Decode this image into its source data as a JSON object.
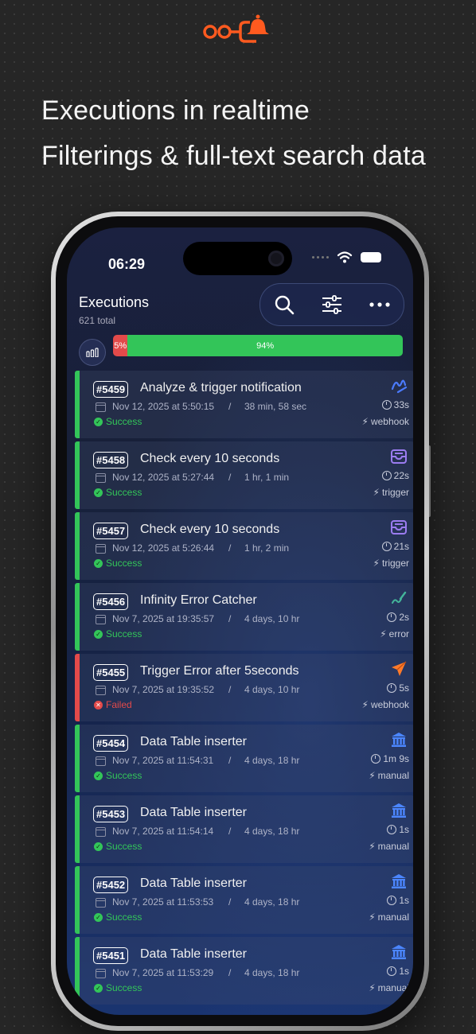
{
  "headline": {
    "line1": "Executions in realtime",
    "line2": "Filterings & full-text search data"
  },
  "status_bar": {
    "time": "06:29"
  },
  "screen": {
    "title": "Executions",
    "subtitle": "621 total",
    "toolbar": {
      "search_icon": "search-icon",
      "filter_icon": "sliders-icon",
      "more_icon": "more-icon"
    },
    "summary": {
      "failed_label": "5%",
      "success_label": "94%",
      "failed_fraction": 0.05,
      "success_fraction": 0.94
    }
  },
  "colors": {
    "success": "#33c559",
    "failed": "#e34a4a",
    "accent": "#ff5a1f"
  },
  "executions": [
    {
      "id": "#5459",
      "name": "Analyze & trigger notification",
      "date": "Nov 12, 2025 at 5:50:15",
      "ago": "38 min, 58 sec",
      "status": "Success",
      "duration": "33s",
      "trigger": "webhook",
      "icon": "webhook-icon"
    },
    {
      "id": "#5458",
      "name": "Check every 10 seconds",
      "date": "Nov 12, 2025 at 5:27:44",
      "ago": "1 hr, 1 min",
      "status": "Success",
      "duration": "22s",
      "trigger": "trigger",
      "icon": "inbox-icon"
    },
    {
      "id": "#5457",
      "name": "Check every 10 seconds",
      "date": "Nov 12, 2025 at 5:26:44",
      "ago": "1 hr, 2 min",
      "status": "Success",
      "duration": "21s",
      "trigger": "trigger",
      "icon": "inbox-icon"
    },
    {
      "id": "#5456",
      "name": "Infinity Error Catcher",
      "date": "Nov 7, 2025 at 19:35:57",
      "ago": "4 days, 10 hr",
      "status": "Success",
      "duration": "2s",
      "trigger": "error",
      "icon": "pen-icon"
    },
    {
      "id": "#5455",
      "name": "Trigger Error after 5seconds",
      "date": "Nov 7, 2025 at 19:35:52",
      "ago": "4 days, 10 hr",
      "status": "Failed",
      "duration": "5s",
      "trigger": "webhook",
      "icon": "send-icon"
    },
    {
      "id": "#5454",
      "name": "Data Table inserter",
      "date": "Nov 7, 2025 at 11:54:31",
      "ago": "4 days, 18 hr",
      "status": "Success",
      "duration": "1m 9s",
      "trigger": "manual",
      "icon": "bank-icon"
    },
    {
      "id": "#5453",
      "name": "Data Table inserter",
      "date": "Nov 7, 2025 at 11:54:14",
      "ago": "4 days, 18 hr",
      "status": "Success",
      "duration": "1s",
      "trigger": "manual",
      "icon": "bank-icon"
    },
    {
      "id": "#5452",
      "name": "Data Table inserter",
      "date": "Nov 7, 2025 at 11:53:53",
      "ago": "4 days, 18 hr",
      "status": "Success",
      "duration": "1s",
      "trigger": "manual",
      "icon": "bank-icon"
    },
    {
      "id": "#5451",
      "name": "Data Table inserter",
      "date": "Nov 7, 2025 at 11:53:29",
      "ago": "4 days, 18 hr",
      "status": "Success",
      "duration": "1s",
      "trigger": "manual",
      "icon": "bank-icon"
    }
  ]
}
